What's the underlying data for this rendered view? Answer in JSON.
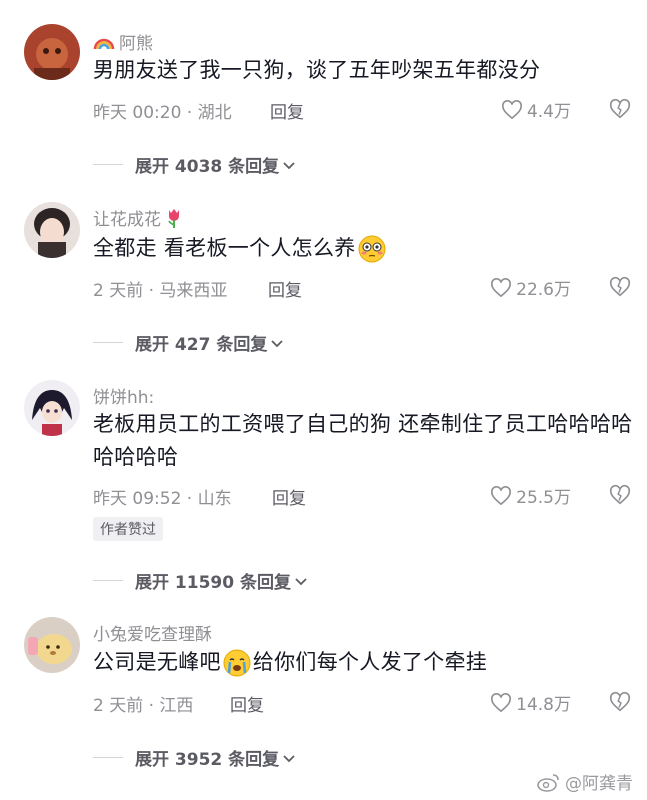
{
  "comments": [
    {
      "username": "阿熊",
      "text": "男朋友送了我一只狗，谈了五年吵架五年都没分",
      "meta": "昨天 00:20 · 湖北",
      "reply_label": "回复",
      "likes": "4.4万",
      "expand_label": "展开 4038 条回复"
    },
    {
      "username": "让花成花",
      "text": "全都走 看老板一个人怎么养",
      "meta": "2 天前 · 马来西亚",
      "reply_label": "回复",
      "likes": "22.6万",
      "expand_label": "展开 427 条回复"
    },
    {
      "username": "饼饼hh:",
      "text": "老板用员工的工资喂了自己的狗 还牵制住了员工哈哈哈哈哈哈哈哈",
      "meta": "昨天 09:52 · 山东",
      "reply_label": "回复",
      "likes": "25.5万",
      "badge": "作者赞过",
      "expand_label": "展开 11590 条回复"
    },
    {
      "username": "小兔爱吃查理酥",
      "text_before": "公司是无峰吧",
      "text_after": "给你们每个人发了个牵挂",
      "meta": "2 天前 · 江西",
      "reply_label": "回复",
      "likes": "14.8万",
      "expand_label": "展开 3952 条回复"
    }
  ],
  "watermark": "@阿龚青"
}
